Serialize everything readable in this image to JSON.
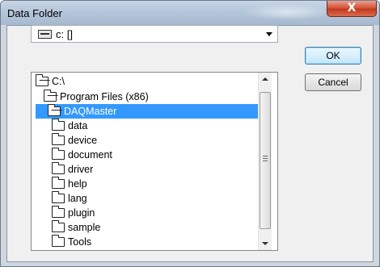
{
  "window": {
    "title": "Data Folder",
    "close_label": "X"
  },
  "drive": {
    "selected": "c: []"
  },
  "buttons": {
    "ok": "OK",
    "cancel": "Cancel"
  },
  "tree": {
    "items": [
      {
        "label": "C:\\"
      },
      {
        "label": "Program Files (x86)"
      },
      {
        "label": "DAQMaster",
        "selected": true
      },
      {
        "label": "data"
      },
      {
        "label": "device"
      },
      {
        "label": "document"
      },
      {
        "label": "driver"
      },
      {
        "label": "help"
      },
      {
        "label": "lang"
      },
      {
        "label": "plugin"
      },
      {
        "label": "sample"
      },
      {
        "label": "Tools"
      }
    ]
  },
  "colors": {
    "selection": "#3399ff",
    "title_bar": "#b4c6da",
    "close_button": "#d5573b"
  },
  "icons": {
    "drive": "drive-icon",
    "folder": "folder-icon",
    "open_folder": "open-folder-icon"
  }
}
